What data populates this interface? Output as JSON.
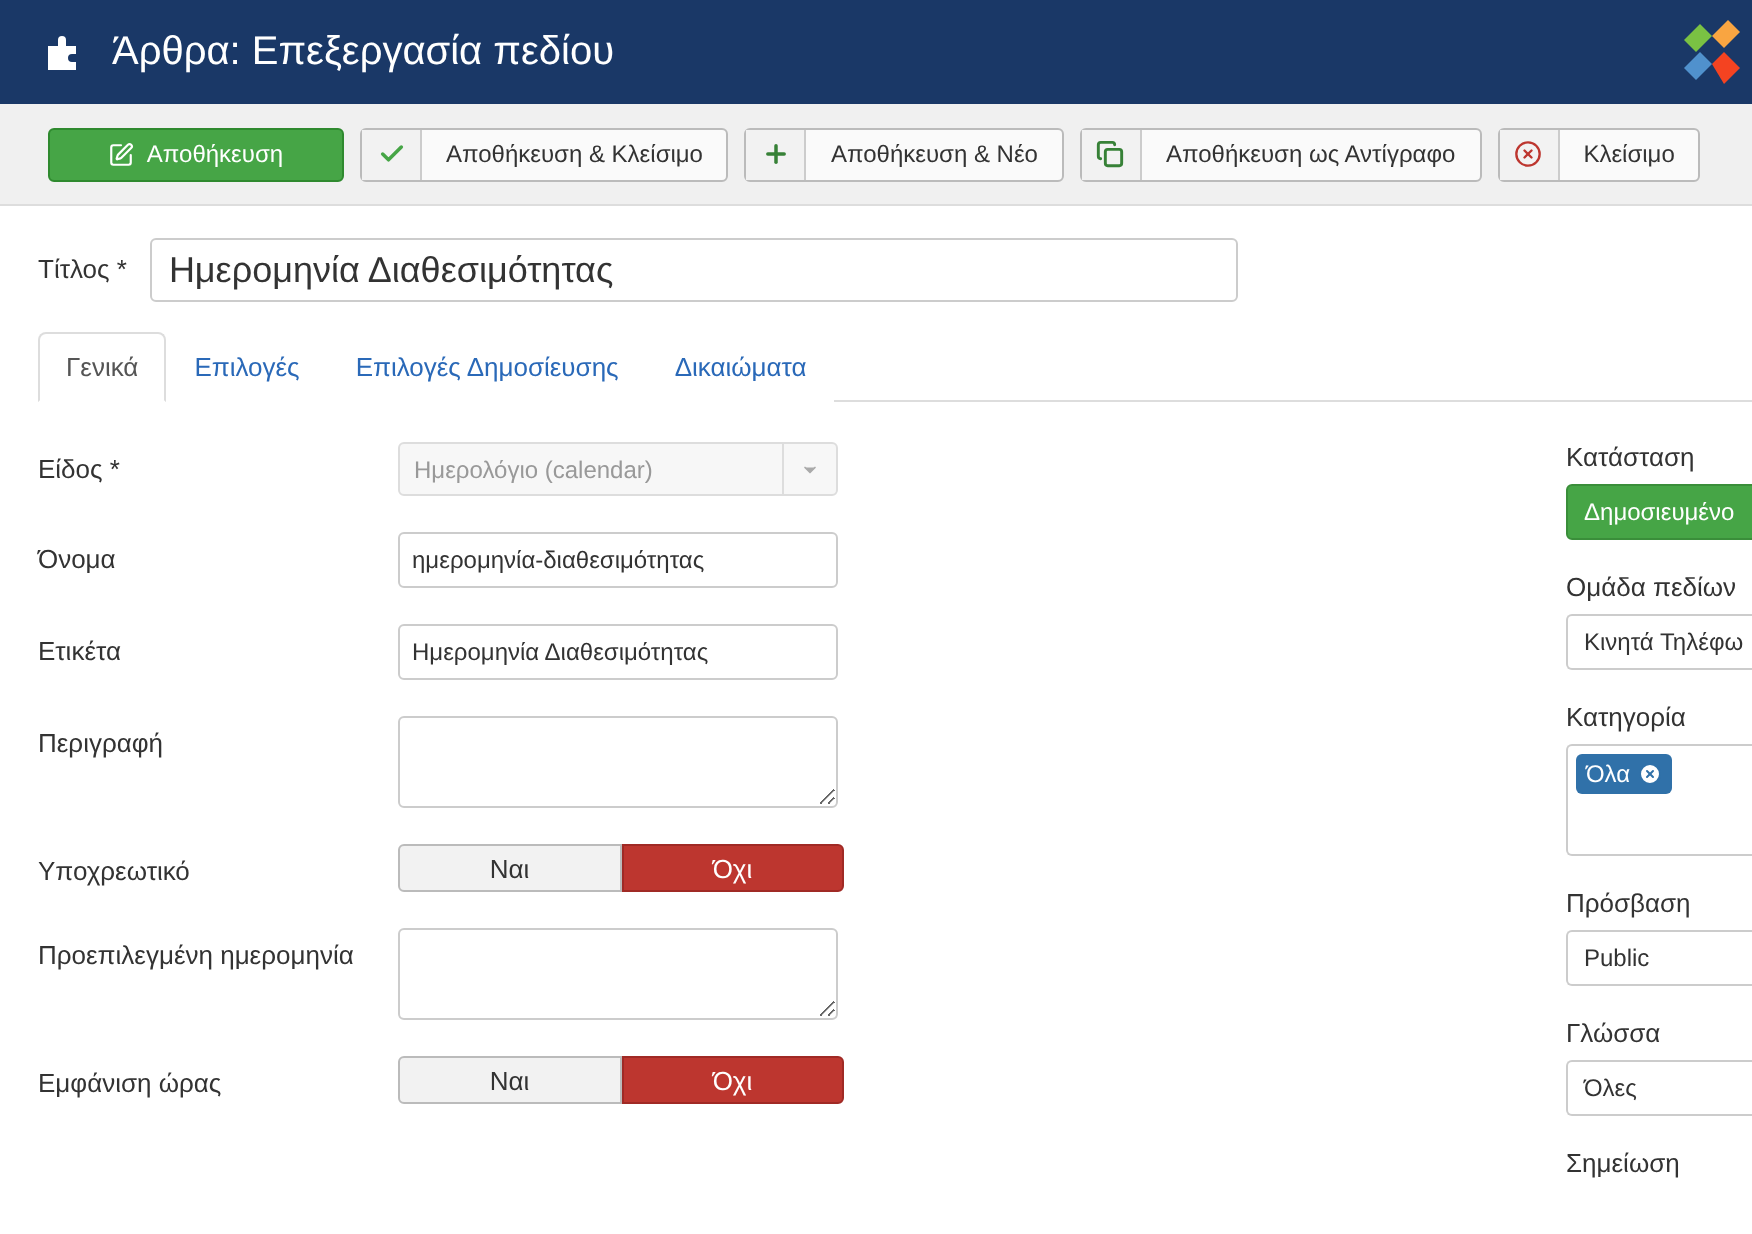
{
  "header": {
    "title": "Άρθρα: Επεξεργασία πεδίου"
  },
  "toolbar": [
    {
      "label": "Αποθήκευση",
      "kind": "primary"
    },
    {
      "label": "Αποθήκευση & Κλείσιμο",
      "kind": "default"
    },
    {
      "label": "Αποθήκευση & Νέο",
      "kind": "default"
    },
    {
      "label": "Αποθήκευση ως Αντίγραφο",
      "kind": "default"
    },
    {
      "label": "Κλείσιμο",
      "kind": "default"
    }
  ],
  "title_field": {
    "label": "Τίτλος *",
    "value": "Ημερομηνία Διαθεσιμότητας"
  },
  "tabs": [
    {
      "label": "Γενικά",
      "selected": true
    },
    {
      "label": "Επιλογές",
      "selected": false
    },
    {
      "label": "Επιλογές Δημοσίευσης",
      "selected": false
    },
    {
      "label": "Δικαιώματα",
      "selected": false
    }
  ],
  "fields": [
    {
      "label": "Είδος *",
      "kind": "select",
      "value": "Ημερολόγιο (calendar)",
      "disabled": true
    },
    {
      "label": "Όνομα",
      "kind": "text",
      "value": "ημερομηνία-διαθεσιμότητας"
    },
    {
      "label": "Ετικέτα",
      "kind": "text",
      "value": "Ημερομηνία Διαθεσιμότητας"
    },
    {
      "label": "Περιγραφή",
      "kind": "textarea"
    },
    {
      "label": "Υποχρεωτικό",
      "kind": "toggle",
      "options": [
        {
          "label": "Ναι",
          "selected": false
        },
        {
          "label": "Όχι",
          "selected": true
        }
      ]
    },
    {
      "label": "Προεπιλεγμένη ημερομηνία",
      "kind": "textarea"
    },
    {
      "label": "Εμφάνιση ώρας",
      "kind": "toggle",
      "options": [
        {
          "label": "Ναι",
          "selected": false
        },
        {
          "label": "Όχι",
          "selected": true
        }
      ]
    }
  ],
  "sidebar": [
    {
      "label": "Κατάσταση",
      "kind": "status",
      "value": "Δημοσιευμένο"
    },
    {
      "label": "Ομάδα πεδίων",
      "kind": "select",
      "value": "Κινητά Τηλέφω"
    },
    {
      "label": "Κατηγορία",
      "kind": "tags",
      "tags": [
        "Όλα"
      ]
    },
    {
      "label": "Πρόσβαση",
      "kind": "select",
      "value": "Public"
    },
    {
      "label": "Γλώσσα",
      "kind": "select",
      "value": "Όλες"
    },
    {
      "label": "Σημείωση",
      "kind": "label"
    }
  ]
}
